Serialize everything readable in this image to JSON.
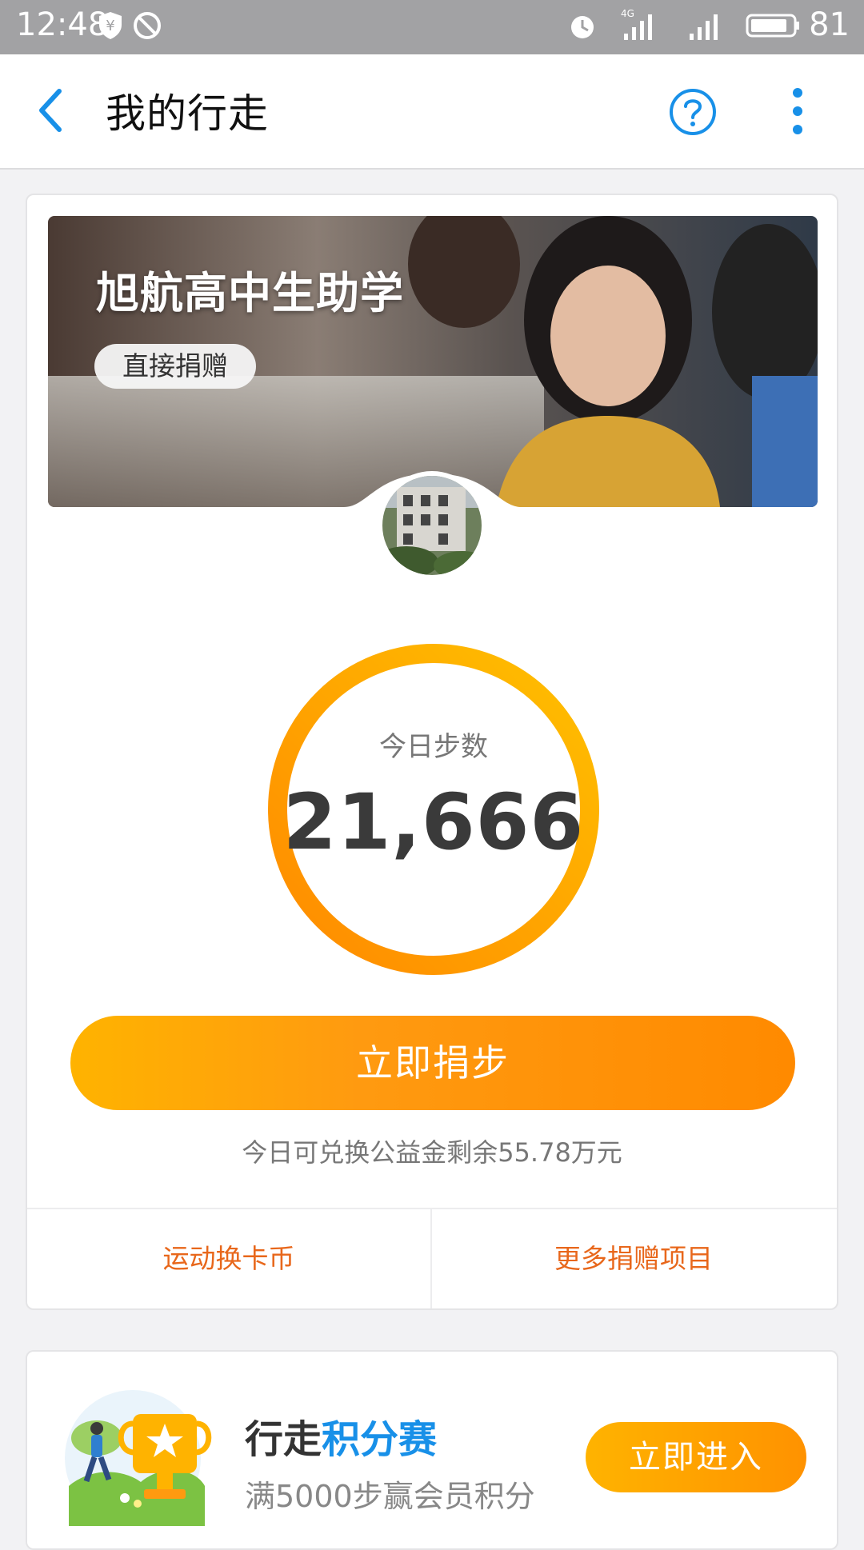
{
  "status_bar": {
    "time": "12:48",
    "network": "4G",
    "battery": "81"
  },
  "nav": {
    "title": "我的行走",
    "back_icon": "chevron-left-icon",
    "help_icon": "question-circle-icon",
    "more_icon": "more-vertical-icon"
  },
  "project": {
    "title": "旭航高中生助学",
    "direct_donate_label": "直接捐赠"
  },
  "steps": {
    "label": "今日步数",
    "value": "21,666"
  },
  "donate_button_label": "立即捐步",
  "fund_note": "今日可兑换公益金剩余55.78万元",
  "links": {
    "left": "运动换卡币",
    "right": "更多捐赠项目"
  },
  "contest": {
    "title_prefix": "行走",
    "title_highlight": "积分赛",
    "subtitle": "满5000步赢会员积分",
    "button_label": "立即进入"
  },
  "colors": {
    "accent_orange": "#ff9a10",
    "link_orange": "#e8671b",
    "nav_blue": "#1890e8"
  }
}
